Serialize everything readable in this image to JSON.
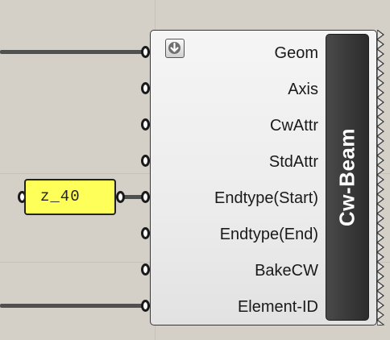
{
  "canvas": {
    "background_color": "#d4d0c8",
    "grid_color": "#c6c2ba",
    "wire_color": "#505050"
  },
  "panel": {
    "text": "z_40",
    "background_color": "#ffff5a"
  },
  "component": {
    "nickname": "Cw-Beam",
    "menu_icon": "arrow-down-icon",
    "inputs": [
      {
        "label": "Geom",
        "connected": true
      },
      {
        "label": "Axis",
        "connected": false
      },
      {
        "label": "CwAttr",
        "connected": false
      },
      {
        "label": "StdAttr",
        "connected": false
      },
      {
        "label": "Endtype(Start)",
        "connected": true
      },
      {
        "label": "Endtype(End)",
        "connected": false
      },
      {
        "label": "BakeCW",
        "connected": false
      },
      {
        "label": "Element-ID",
        "connected": true
      }
    ]
  }
}
